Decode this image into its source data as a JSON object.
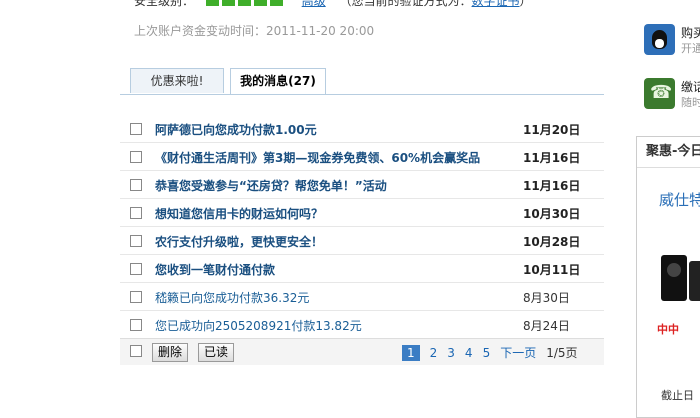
{
  "account": {
    "level_label": "安全级别：",
    "level_link": "高级",
    "verify_prefix": "（您当前的验证方式为：",
    "verify_link": "数字证书",
    "verify_suffix": "）",
    "last_change": "上次账户资金变动时间：2011-11-20 20:00"
  },
  "tabs": [
    {
      "label": "优惠来啦!"
    },
    {
      "label": "我的消息(27)"
    }
  ],
  "messages": [
    {
      "title": "阿萨德已向您成功付款1.00元",
      "date": "11月20日"
    },
    {
      "title": "《财付通生活周刊》第3期—现金券免费领、60%机会赢奖品",
      "date": "11月16日"
    },
    {
      "title": "恭喜您受邀参与“还房贷？帮您免单！”活动",
      "date": "11月16日"
    },
    {
      "title": "想知道您信用卡的财运如何吗？",
      "date": "10月30日"
    },
    {
      "title": "农行支付升级啦，更快更安全！",
      "date": "10月28日"
    },
    {
      "title": "您收到一笔财付通付款",
      "date": "10月11日"
    },
    {
      "title": "嵇籁已向您成功付款36.32元",
      "date": "8月30日"
    },
    {
      "title": "您已成功向2505208921付款13.82元",
      "date": "8月24日"
    }
  ],
  "footer": {
    "delete_label": "删除",
    "read_label": "已读",
    "pages": [
      "1",
      "2",
      "3",
      "4",
      "5"
    ],
    "active_page": "1",
    "next_label": "下一页",
    "total": "1/5页"
  },
  "side": {
    "item1_title": "购买",
    "item1_sub": "开通",
    "item2_title": "缴话",
    "item2_sub": "随时",
    "promo_head": "聚惠-今日",
    "promo_title": "威仕特",
    "promo_brand": "中中",
    "promo_deadline": "截止日"
  },
  "colors": {
    "link": "#1a66b3",
    "active_page": "#3b7dc4",
    "level_bar": "#3fae2a"
  }
}
